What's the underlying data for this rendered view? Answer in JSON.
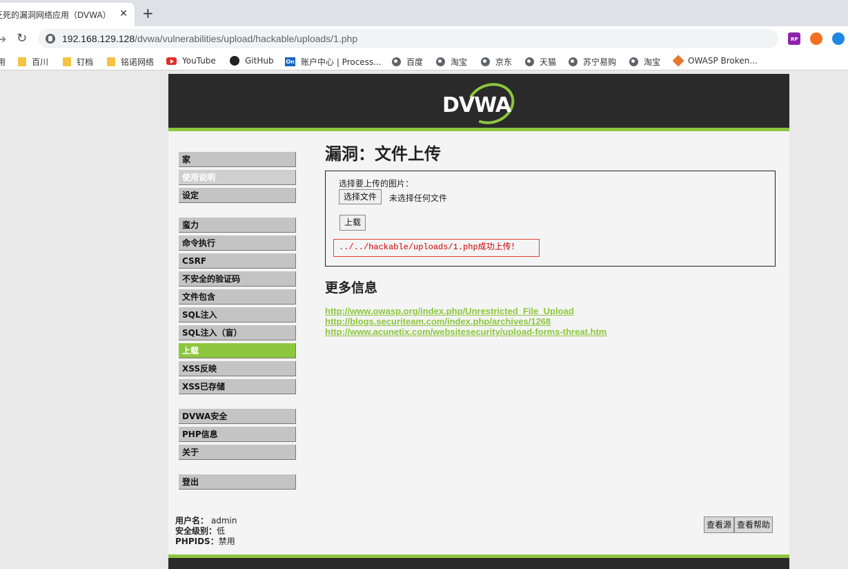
{
  "browser": {
    "tab_title": "乏死的漏洞网络应用（DVWA）",
    "tab_close": "✕",
    "new_tab": "+",
    "url_host": "192.168.129.128",
    "url_path": "/dvwa/vulnerabilities/upload/hackable/uploads/1.php"
  },
  "bookmarks": [
    {
      "label": "用",
      "icon": "none"
    },
    {
      "label": "百川",
      "icon": "folder"
    },
    {
      "label": "钉档",
      "icon": "folder"
    },
    {
      "label": "铭诺网络",
      "icon": "folder"
    },
    {
      "label": "YouTube",
      "icon": "youtube"
    },
    {
      "label": "GitHub",
      "icon": "github"
    },
    {
      "label": "账户中心 | Process...",
      "icon": "on"
    },
    {
      "label": "百度",
      "icon": "globe"
    },
    {
      "label": "淘宝",
      "icon": "globe"
    },
    {
      "label": "京东",
      "icon": "globe"
    },
    {
      "label": "天猫",
      "icon": "globe"
    },
    {
      "label": "苏宁易购",
      "icon": "globe"
    },
    {
      "label": "淘宝",
      "icon": "globe"
    },
    {
      "label": "OWASP Broken...",
      "icon": "owasp"
    }
  ],
  "logo": "DVWA",
  "menu": {
    "home": "家",
    "instructions": "使用说明",
    "setup": "设定",
    "brute": "蛮力",
    "exec": "命令执行",
    "csrf": "CSRF",
    "captcha": "不安全的验证码",
    "fi": "文件包含",
    "sqli": "SQL注入",
    "sqli_blind": "SQL注入（盲）",
    "upload": "上载",
    "xss_r": "XSS反映",
    "xss_s": "XSS已存储",
    "security": "DVWA安全",
    "phpinfo": "PHP信息",
    "about": "关于",
    "logout": "登出"
  },
  "main": {
    "title": "漏洞：文件上传",
    "upload_label": "选择要上传的图片：",
    "choose_file": "选择文件",
    "no_file": "未选择任何文件",
    "upload_button": "上载",
    "message": "../../hackable/uploads/1.php成功上传！",
    "more_info": "更多信息",
    "links": [
      "http://www.owasp.org/index.php/Unrestricted_File_Upload",
      "http://blogs.securiteam.com/index.php/archives/1268",
      "http://www.acunetix.com/websitesecurity/upload-forms-threat.htm"
    ]
  },
  "footer_info": {
    "user_label": "用户名：",
    "user": "admin",
    "level_label": "安全级别：",
    "level": "低",
    "phpids_label": "PHPIDS：",
    "phpids": "禁用"
  },
  "buttons": {
    "view_source": "查看源",
    "view_help": "查看帮助"
  }
}
